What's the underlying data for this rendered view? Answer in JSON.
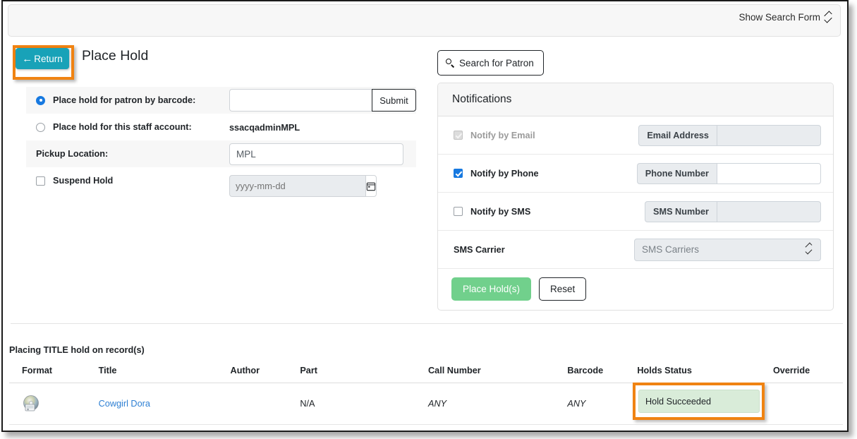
{
  "topbar": {
    "toggle_label": "Show Search Form",
    "toggle_icon": "updown-chevron-icon"
  },
  "header": {
    "return_label": "Return",
    "return_icon": "left-arrow-icon",
    "page_title": "Place Hold"
  },
  "left_form": {
    "rows": [
      {
        "label": "Place hold for patron by barcode:",
        "control": "radio",
        "checked": true
      },
      {
        "label": "Place hold for this staff account:",
        "control": "radio",
        "checked": false
      },
      {
        "label": "Pickup Location:",
        "control": "none"
      },
      {
        "label": "Suspend Hold",
        "control": "checkbox",
        "checked": false
      }
    ],
    "barcode_value": "",
    "barcode_placeholder": "",
    "submit_label": "Submit",
    "staff_account_value": "ssacqadminMPL",
    "pickup_location_value": "MPL",
    "suspend_date_value": "",
    "suspend_date_placeholder": "yyyy-mm-dd",
    "calendar_icon": "calendar-icon"
  },
  "right_panel": {
    "search_patron_label": "Search for Patron",
    "search_icon": "search-icon",
    "notifications_title": "Notifications",
    "rows": [
      {
        "label": "Notify by Email",
        "checked": true,
        "disabled": true,
        "addon": "Email Address",
        "value": "",
        "input_disabled": true
      },
      {
        "label": "Notify by Phone",
        "checked": true,
        "disabled": false,
        "addon": "Phone Number",
        "value": "",
        "input_disabled": false
      },
      {
        "label": "Notify by SMS",
        "checked": false,
        "disabled": false,
        "addon": "SMS Number",
        "value": "",
        "input_disabled": true
      }
    ],
    "sms_carrier_label": "SMS Carrier",
    "sms_carrier_selected": "SMS Carriers",
    "place_holds_label": "Place Hold(s)",
    "reset_label": "Reset",
    "accent_green": "#71d08c",
    "accent_teal": "#18a2b8",
    "highlight_orange": "#f08312"
  },
  "records": {
    "caption": "Placing TITLE hold on record(s)",
    "columns": [
      "Format",
      "Title",
      "Author",
      "Part",
      "Call Number",
      "Barcode",
      "Holds Status",
      "Override"
    ],
    "rows": [
      {
        "format_icon": "dvd-disc-icon",
        "title": "Cowgirl Dora",
        "author": "",
        "part": "N/A",
        "call_number": "ANY",
        "barcode": "ANY",
        "holds_status": "Hold Succeeded",
        "override": ""
      }
    ]
  }
}
